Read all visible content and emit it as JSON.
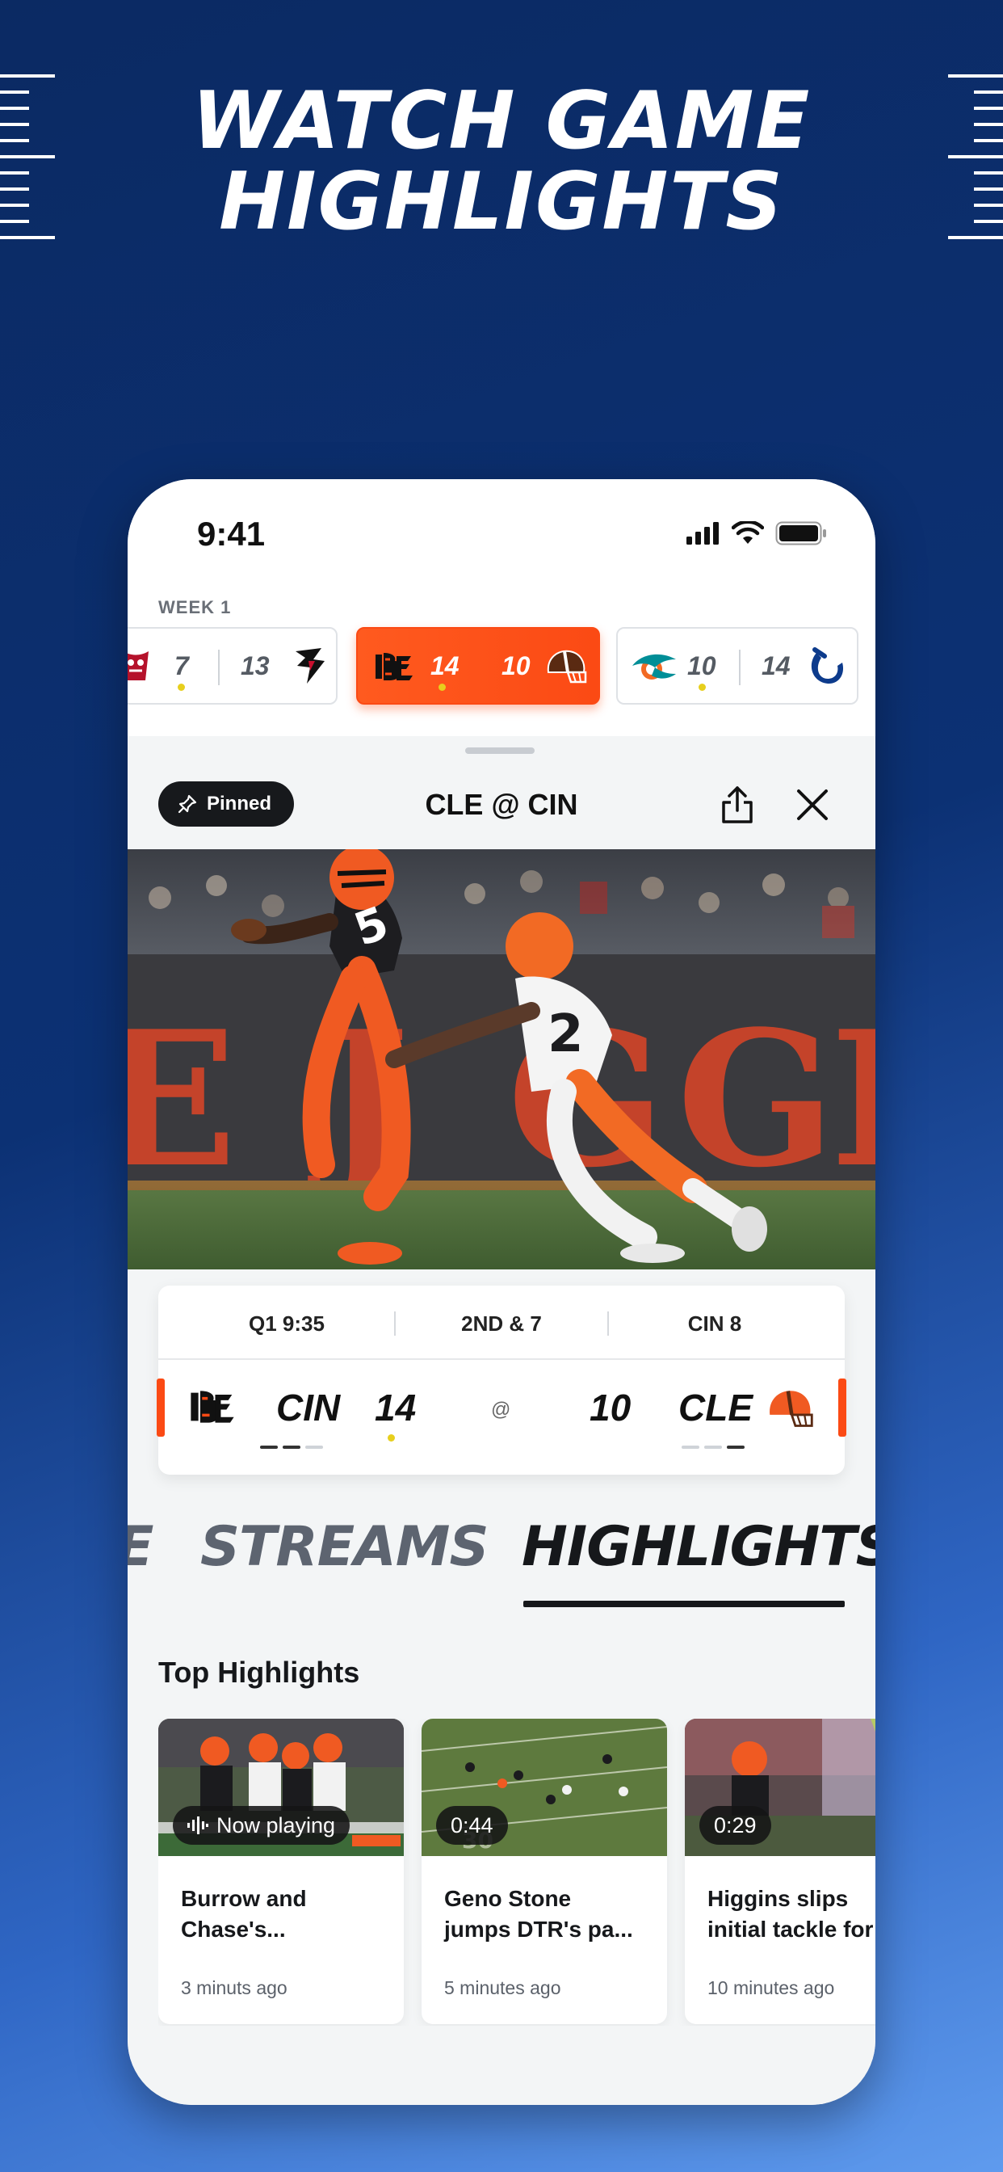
{
  "headline": {
    "line1": "WATCH GAME",
    "line2": "HIGHLIGHTS"
  },
  "status_bar": {
    "time": "9:41"
  },
  "scores_strip": {
    "week_label": "WEEK 1",
    "games": [
      {
        "away_logo": "buccaneers-logo",
        "away_score": "7",
        "home_score": "13",
        "home_logo": "falcons-logo",
        "active": false
      },
      {
        "away_logo": "bengals-logo",
        "away_score": "14",
        "home_score": "10",
        "home_logo": "browns-logo",
        "active": true
      },
      {
        "away_logo": "dolphins-logo",
        "away_score": "10",
        "home_score": "14",
        "home_logo": "colts-logo",
        "active": false
      }
    ]
  },
  "sheet": {
    "pinned_label": "Pinned",
    "title": "CLE @ CIN",
    "share_icon": "share-icon",
    "close_icon": "close-icon"
  },
  "scoreboard": {
    "quarter_clock": "Q1 9:35",
    "down_distance": "2ND & 7",
    "field_position": "CIN 8",
    "left_team": {
      "abbr": "CIN",
      "score": "14"
    },
    "at_symbol": "@",
    "right_team": {
      "abbr": "CLE",
      "score": "10"
    }
  },
  "tabs": {
    "partial": "E",
    "streams": "STREAMS",
    "highlights": "HIGHLIGHTS"
  },
  "highlights": {
    "section_title": "Top Highlights",
    "items": [
      {
        "badge": "Now playing",
        "title": "Burrow and\nChase's...",
        "time": "3 minuts ago"
      },
      {
        "badge": "0:44",
        "title": "Geno Stone\njumps DTR's pa...",
        "time": "5 minutes ago"
      },
      {
        "badge": "0:29",
        "title": "Higgins slips\ninitial tackle for",
        "time": "10 minutes ago"
      }
    ]
  },
  "colors": {
    "accent_orange": "#fb4a14",
    "background_navy": "#0b2a63",
    "possession_dot": "#e7cf1d"
  }
}
